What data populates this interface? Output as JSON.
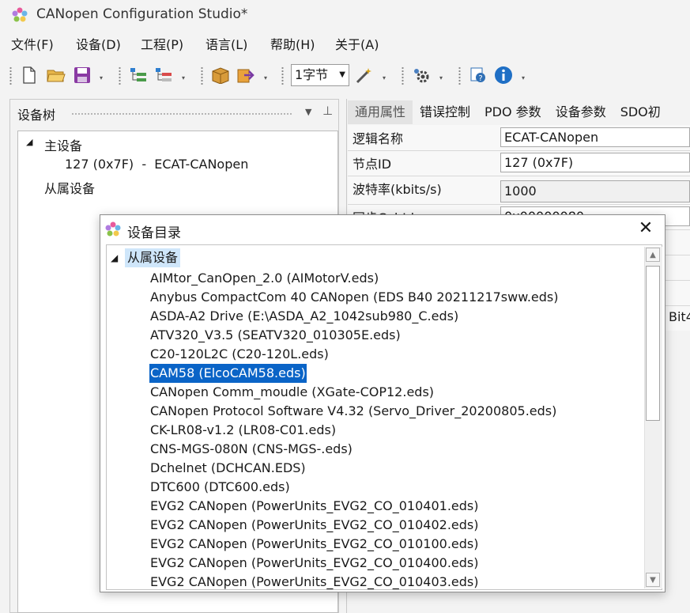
{
  "window": {
    "title": "CANopen Configuration Studio*",
    "icon": "app-flower-icon"
  },
  "menu": [
    "文件(F)",
    "设备(D)",
    "工程(P)",
    "语言(L)",
    "帮助(H)",
    "关于(A)"
  ],
  "toolbar": {
    "icons": [
      "new-file-icon",
      "open-folder-icon",
      "save-icon",
      "add-node-icon",
      "remove-node-icon",
      "package-icon",
      "export-icon",
      "wand-icon",
      "settings-icon",
      "help-icon",
      "info-icon"
    ],
    "byte_select": "1字节"
  },
  "left_pane": {
    "title": "设备树",
    "pin_icon": "pin-icon",
    "tree": {
      "master_label": "主设备",
      "master_node": "127 (0x7F)  -  ECAT-CANopen",
      "slave_label": "从属设备"
    }
  },
  "right_pane": {
    "tabs": [
      "通用属性",
      "错误控制",
      "PDO 参数",
      "设备参数",
      "SDO初"
    ],
    "properties": [
      {
        "label": "逻辑名称",
        "value": "ECAT-CANopen"
      },
      {
        "label": "节点ID",
        "value": "127 (0x7F)"
      },
      {
        "label": "波特率(kbits/s)",
        "value": "1000"
      },
      {
        "label": "同步CobId",
        "value": "0x00000080"
      }
    ],
    "bit_fragment": "Bit4"
  },
  "dialog": {
    "title": "设备目录",
    "root": "从属设备",
    "items": [
      "AIMtor_CanOpen_2.0 (AIMotorV.eds)",
      "Anybus CompactCom 40 CANopen (EDS B40 20211217sww.eds)",
      "ASDA-A2 Drive (E:\\ASDA_A2_1042sub980_C.eds)",
      "ATV320_V3.5 (SEATV320_010305E.eds)",
      "C20-120L2C (C20-120L.eds)",
      "CAM58 (ElcoCAM58.eds)",
      "CANopen Comm_moudle (XGate-COP12.eds)",
      "CANopen Protocol Software V4.32 (Servo_Driver_20200805.eds)",
      "CK-LR08-v1.2 (LR08-C01.eds)",
      "CNS-MGS-080N (CNS-MGS-.eds)",
      "Dchelnet (DCHCAN.EDS)",
      "DTC600 (DTC600.eds)",
      "EVG2 CANopen (PowerUnits_EVG2_CO_010401.eds)",
      "EVG2 CANopen (PowerUnits_EVG2_CO_010402.eds)",
      "EVG2 CANopen (PowerUnits_EVG2_CO_010100.eds)",
      "EVG2 CANopen (PowerUnits_EVG2_CO_010400.eds)",
      "EVG2 CANopen (PowerUnits_EVG2_CO_010403.eds)"
    ],
    "selected_index": 5,
    "close_glyph": "✕"
  },
  "colors": {
    "selection": "#0a64c7",
    "root_highlight": "#cfe6fa",
    "active_tab": "#e3e3e3"
  }
}
